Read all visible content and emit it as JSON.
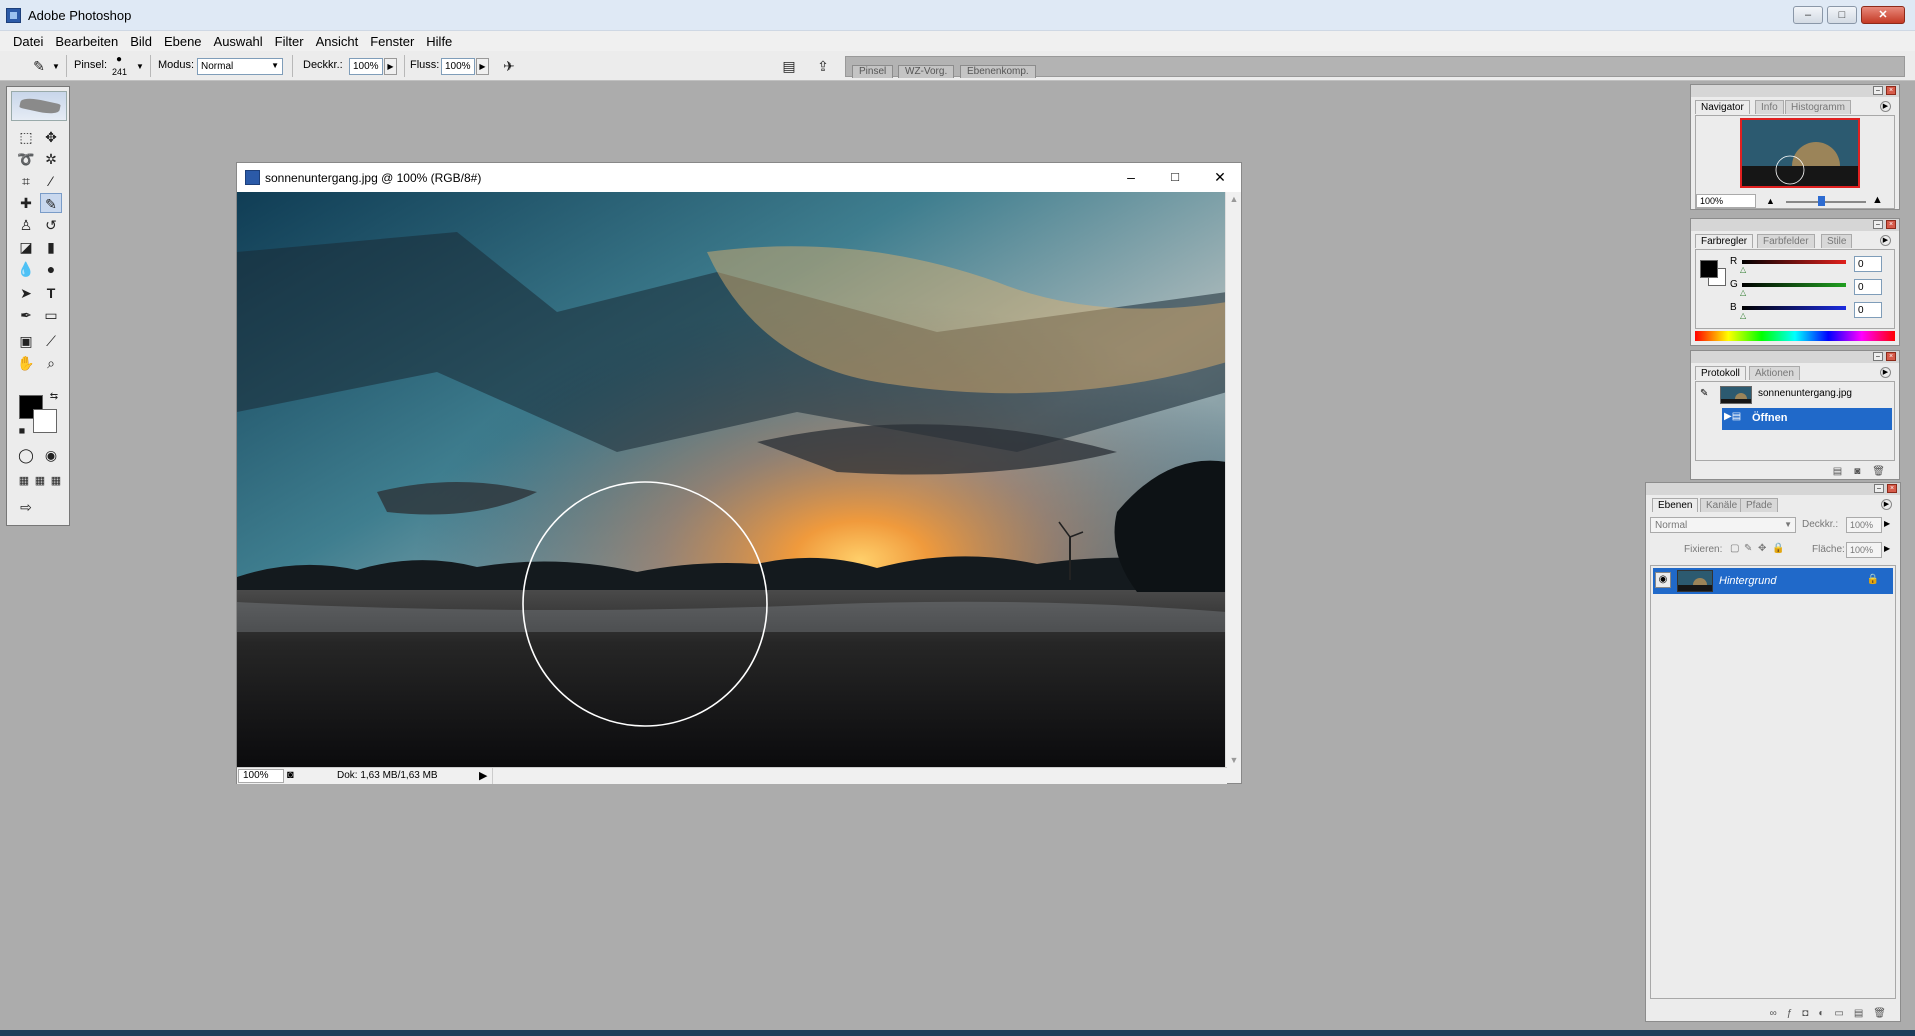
{
  "app": {
    "title": "Adobe Photoshop"
  },
  "window_controls": {
    "minimize": "–",
    "maximize": "□",
    "close": "✕"
  },
  "menu": [
    "Datei",
    "Bearbeiten",
    "Bild",
    "Ebene",
    "Auswahl",
    "Filter",
    "Ansicht",
    "Fenster",
    "Hilfe"
  ],
  "options": {
    "brush_label": "Pinsel:",
    "brush_size": "241",
    "mode_label": "Modus:",
    "mode_value": "Normal",
    "opacity_label": "Deckkr.:",
    "opacity_value": "100%",
    "flow_label": "Fluss:",
    "flow_value": "100%",
    "well_tabs": [
      "Pinsel",
      "WZ-Vorg.",
      "Ebenenkomp."
    ]
  },
  "document": {
    "title": "sonnenuntergang.jpg @ 100% (RGB/8#)",
    "zoom": "100%",
    "status_info": "Dok: 1,63 MB/1,63 MB"
  },
  "navigator": {
    "tabs": [
      "Navigator",
      "Info",
      "Histogramm"
    ],
    "zoom": "100%"
  },
  "color": {
    "tabs": [
      "Farbregler",
      "Farbfelder",
      "Stile"
    ],
    "channels": [
      {
        "label": "R",
        "value": "0",
        "color": "#e0201c"
      },
      {
        "label": "G",
        "value": "0",
        "color": "#20a020"
      },
      {
        "label": "B",
        "value": "0",
        "color": "#1c2ce0"
      }
    ]
  },
  "history": {
    "tabs": [
      "Protokoll",
      "Aktionen"
    ],
    "snapshot": "sonnenuntergang.jpg",
    "step": "Öffnen"
  },
  "layers": {
    "tabs": [
      "Ebenen",
      "Kanäle",
      "Pfade"
    ],
    "blend_mode": "Normal",
    "opacity_label": "Deckkr.:",
    "opacity_value": "100%",
    "lock_label": "Fixieren:",
    "fill_label": "Fläche:",
    "fill_value": "100%",
    "layer_name": "Hintergrund"
  },
  "colors": {
    "selection": "#2069c9",
    "workspace": "#acacac"
  }
}
